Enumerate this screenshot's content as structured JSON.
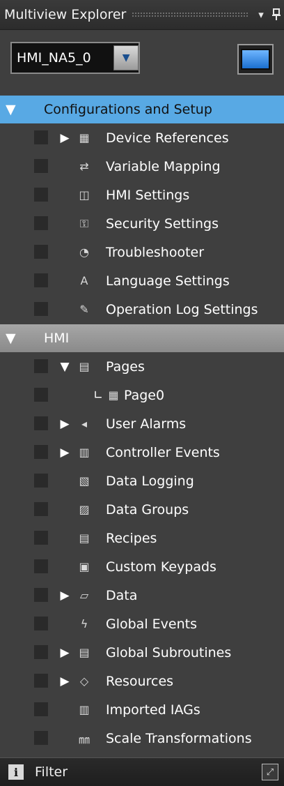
{
  "panel": {
    "title": "Multiview Explorer",
    "icons": {
      "dropdown": "chevron-down-icon",
      "pin": "pin-icon"
    }
  },
  "toolbar": {
    "device_value": "HMI_NA5_0",
    "screen_icon": "display-screen-icon"
  },
  "sections": {
    "config": {
      "label": "Configurations and Setup",
      "items": [
        {
          "label": "Device References",
          "icon": "device-references-icon",
          "expander": "▶"
        },
        {
          "label": "Variable Mapping",
          "icon": "variable-mapping-icon"
        },
        {
          "label": "HMI Settings",
          "icon": "hmi-settings-icon"
        },
        {
          "label": "Security Settings",
          "icon": "security-settings-icon"
        },
        {
          "label": "Troubleshooter",
          "icon": "troubleshooter-icon"
        },
        {
          "label": "Language Settings",
          "icon": "language-settings-icon"
        },
        {
          "label": "Operation Log Settings",
          "icon": "operation-log-icon"
        }
      ]
    },
    "hmi": {
      "label": "HMI",
      "items": [
        {
          "label": "Pages",
          "icon": "pages-icon",
          "expander": "▼"
        },
        {
          "label": "Page0",
          "icon": "page-icon",
          "prefix": "∟"
        },
        {
          "label": "User Alarms",
          "icon": "user-alarms-icon",
          "expander": "▶"
        },
        {
          "label": "Controller Events",
          "icon": "controller-events-icon",
          "expander": "▶"
        },
        {
          "label": "Data Logging",
          "icon": "data-logging-icon"
        },
        {
          "label": "Data Groups",
          "icon": "data-groups-icon"
        },
        {
          "label": "Recipes",
          "icon": "recipes-icon"
        },
        {
          "label": "Custom Keypads",
          "icon": "custom-keypads-icon"
        },
        {
          "label": "Data",
          "icon": "data-icon",
          "expander": "▶"
        },
        {
          "label": "Global Events",
          "icon": "global-events-icon"
        },
        {
          "label": "Global Subroutines",
          "icon": "global-subroutines-icon",
          "expander": "▶"
        },
        {
          "label": "Resources",
          "icon": "resources-icon",
          "expander": "▶"
        },
        {
          "label": "Imported IAGs",
          "icon": "imported-iags-icon"
        },
        {
          "label": "Scale Transformations",
          "icon": "scale-transformations-icon"
        }
      ]
    }
  },
  "footer": {
    "filter_label": "Filter"
  },
  "colors": {
    "selected_section": "#58a9e4",
    "panel_bg": "#3f3f3f"
  }
}
